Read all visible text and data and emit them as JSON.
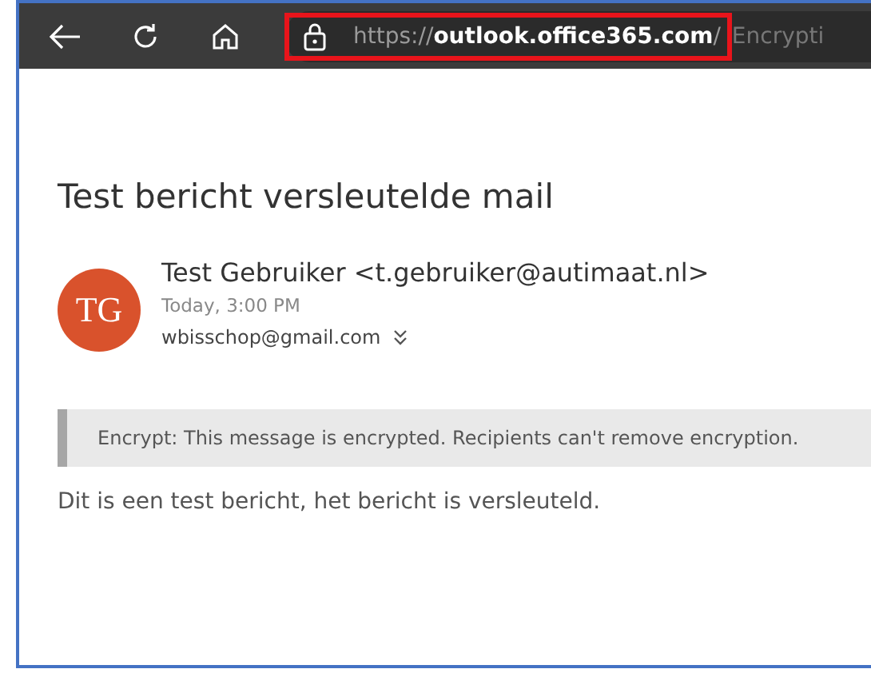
{
  "browser": {
    "url_scheme": "https://",
    "url_host": "outlook.office365.com",
    "url_slash": "/",
    "url_path": "Encrypti",
    "url_highlighted": true
  },
  "message": {
    "subject": "Test bericht versleutelde mail",
    "avatar_initials": "TG",
    "sender": "Test Gebruiker <t.gebruiker@autimaat.nl>",
    "time": "Today, 3:00 PM",
    "recipients": "wbisschop@gmail.com",
    "banner": "Encrypt: This message is encrypted. Recipients can't remove encryption.",
    "body": "Dit is een test bericht, het bericht is versleuteld."
  }
}
